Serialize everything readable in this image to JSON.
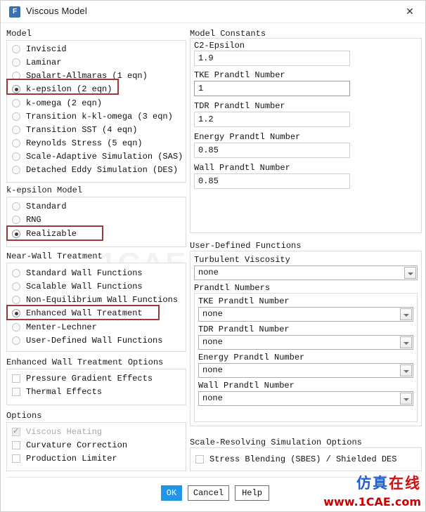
{
  "window": {
    "title": "Viscous Model",
    "icon": "fluent-app-icon",
    "icon_letter": "F",
    "close_label": "✕"
  },
  "left": {
    "model": {
      "label": "Model",
      "items": [
        {
          "label": "Inviscid",
          "selected": false
        },
        {
          "label": "Laminar",
          "selected": false
        },
        {
          "label": "Spalart-Allmaras (1 eqn)",
          "selected": false
        },
        {
          "label": "k-epsilon (2 eqn)",
          "selected": true,
          "highlighted": true
        },
        {
          "label": "k-omega (2 eqn)",
          "selected": false
        },
        {
          "label": "Transition k-kl-omega (3 eqn)",
          "selected": false
        },
        {
          "label": "Transition SST (4 eqn)",
          "selected": false
        },
        {
          "label": "Reynolds Stress (5 eqn)",
          "selected": false
        },
        {
          "label": "Scale-Adaptive Simulation (SAS)",
          "selected": false
        },
        {
          "label": "Detached Eddy Simulation (DES)",
          "selected": false
        }
      ]
    },
    "ke_model": {
      "label": "k-epsilon Model",
      "items": [
        {
          "label": "Standard",
          "selected": false
        },
        {
          "label": "RNG",
          "selected": false
        },
        {
          "label": "Realizable",
          "selected": true,
          "highlighted": true
        }
      ]
    },
    "near_wall": {
      "label": "Near-Wall Treatment",
      "items": [
        {
          "label": "Standard Wall Functions",
          "selected": false
        },
        {
          "label": "Scalable Wall Functions",
          "selected": false
        },
        {
          "label": "Non-Equilibrium Wall Functions",
          "selected": false
        },
        {
          "label": "Enhanced Wall Treatment",
          "selected": true,
          "highlighted": true
        },
        {
          "label": "Menter-Lechner",
          "selected": false
        },
        {
          "label": "User-Defined Wall Functions",
          "selected": false
        }
      ]
    },
    "ewt_options": {
      "label": "Enhanced Wall Treatment Options",
      "items": [
        {
          "label": "Pressure Gradient Effects",
          "checked": false,
          "disabled": false
        },
        {
          "label": "Thermal Effects",
          "checked": false,
          "disabled": false
        }
      ]
    },
    "options": {
      "label": "Options",
      "items": [
        {
          "label": "Viscous Heating",
          "checked": true,
          "disabled": true
        },
        {
          "label": "Curvature Correction",
          "checked": false,
          "disabled": false
        },
        {
          "label": "Production Limiter",
          "checked": false,
          "disabled": false
        }
      ]
    }
  },
  "right": {
    "model_constants": {
      "label": "Model Constants",
      "fields": [
        {
          "label": "C2-Epsilon",
          "value": "1.9",
          "focused": false
        },
        {
          "label": "TKE Prandtl Number",
          "value": "1",
          "focused": true
        },
        {
          "label": "TDR Prandtl Number",
          "value": "1.2",
          "focused": false
        },
        {
          "label": "Energy Prandtl Number",
          "value": "0.85",
          "focused": false
        },
        {
          "label": "Wall Prandtl Number",
          "value": "0.85",
          "focused": false
        }
      ]
    },
    "udf": {
      "label": "User-Defined Functions",
      "turbulent_viscosity": {
        "label": "Turbulent Viscosity",
        "value": "none"
      },
      "prandtl_numbers": {
        "label": "Prandtl Numbers",
        "fields": [
          {
            "label": "TKE Prandtl Number",
            "value": "none"
          },
          {
            "label": "TDR Prandtl Number",
            "value": "none"
          },
          {
            "label": "Energy Prandtl Number",
            "value": "none"
          },
          {
            "label": "Wall Prandtl Number",
            "value": "none"
          }
        ]
      }
    },
    "srs": {
      "label": "Scale-Resolving Simulation Options",
      "items": [
        {
          "label": "Stress Blending (SBES) / Shielded DES",
          "checked": false
        }
      ]
    }
  },
  "footer": {
    "ok": "OK",
    "cancel": "Cancel",
    "help": "Help"
  },
  "watermark": {
    "center": "1CAE",
    "center2": "1CAE",
    "logo_cn_blue": "仿真",
    "logo_cn_red": "在线",
    "url": "www.1CAE.com",
    "faint_letter": "F"
  },
  "colors": {
    "accent": "#2196e8",
    "highlight": "#9c3a3a",
    "title_icon": "#3a6fb0",
    "watermark_red": "#cc0000",
    "watermark_blue": "#1f5fd0"
  }
}
